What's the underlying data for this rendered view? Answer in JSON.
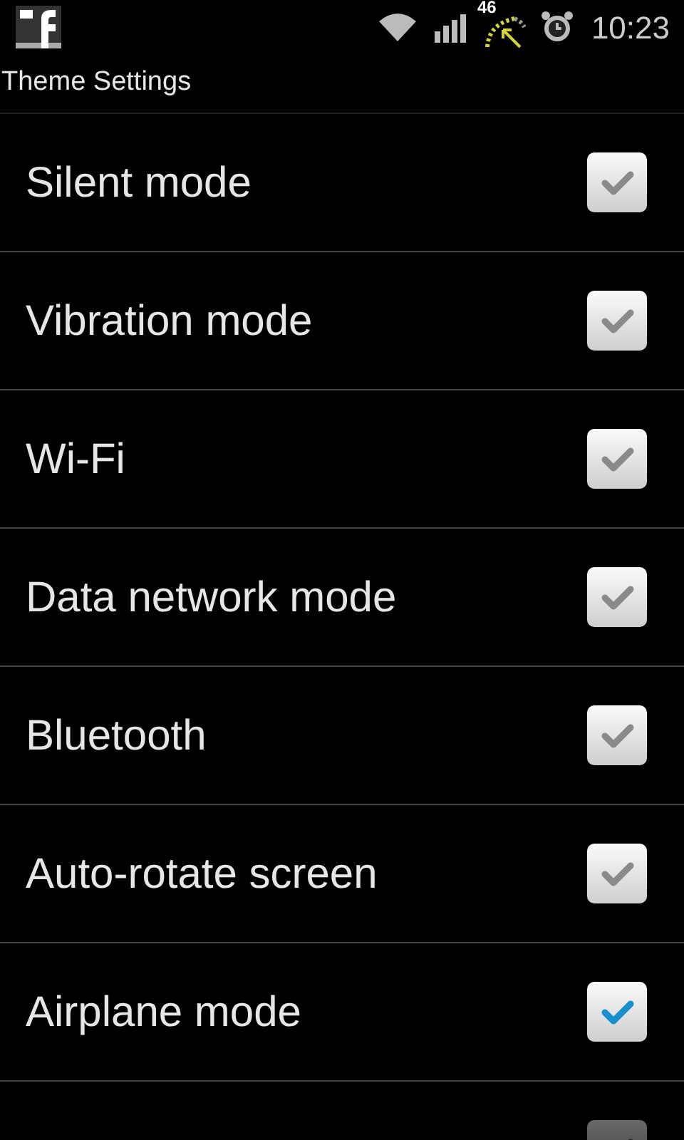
{
  "status_bar": {
    "speed": "46",
    "time": "10:23"
  },
  "title": "Theme Settings",
  "settings": [
    {
      "label": "Silent mode",
      "checked": false,
      "disabled": false
    },
    {
      "label": "Vibration mode",
      "checked": false,
      "disabled": false
    },
    {
      "label": "Wi-Fi",
      "checked": false,
      "disabled": false
    },
    {
      "label": "Data network mode",
      "checked": false,
      "disabled": false
    },
    {
      "label": "Bluetooth",
      "checked": false,
      "disabled": false
    },
    {
      "label": "Auto-rotate screen",
      "checked": false,
      "disabled": false
    },
    {
      "label": "Airplane mode",
      "checked": true,
      "disabled": false
    },
    {
      "checked": false,
      "disabled": true
    }
  ]
}
